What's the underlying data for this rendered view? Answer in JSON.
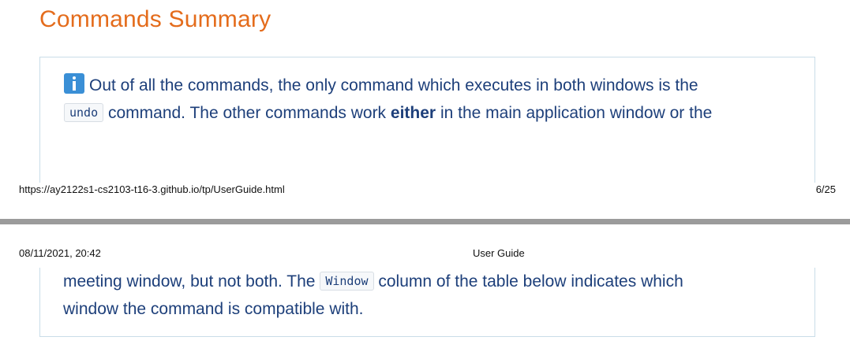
{
  "page1": {
    "section_title": "Commands Summary",
    "note": {
      "icon": "info-icon",
      "segment1": "Out of all the commands, the only command which executes in both windows is the",
      "code1": "undo",
      "segment2": "command. The other commands work",
      "bold1": "either",
      "segment3": "in the main application window or the"
    },
    "footer": {
      "url": "https://ay2122s1-cs2103-t16-3.github.io/tp/UserGuide.html",
      "page": "6/25"
    }
  },
  "page2": {
    "header": {
      "date": "08/11/2021, 20:42",
      "title": "User Guide"
    },
    "note": {
      "segment1": "meeting window, but not both. The",
      "code1": "Window",
      "segment2": "column of the table below indicates which",
      "segment3": "window the command is compatible with."
    }
  },
  "colors": {
    "title": "#e46c1c",
    "text": "#1d3f7a",
    "border": "#c9dde8",
    "separator": "#9b9b9b",
    "icon": "#3a8fd6"
  }
}
